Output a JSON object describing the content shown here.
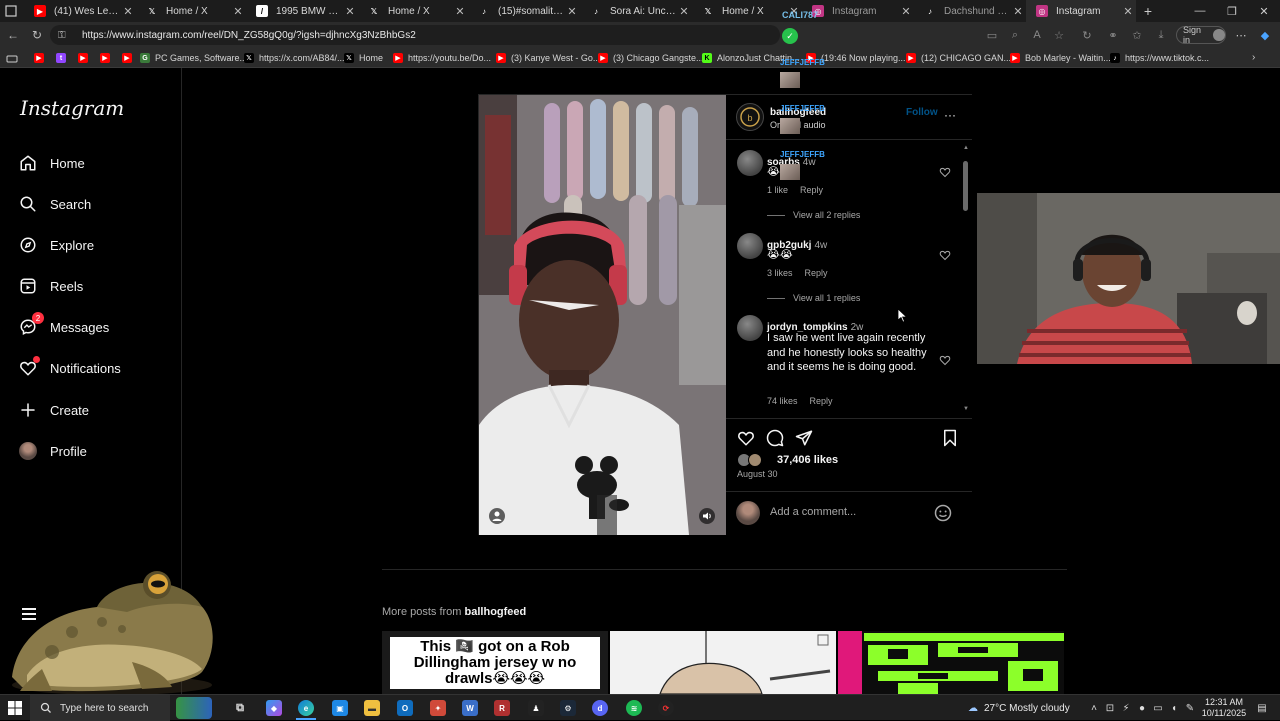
{
  "browser": {
    "tabs": [
      {
        "label": "(41) Wes Lee with th",
        "icon": "youtube-icon",
        "color": "#ff0000"
      },
      {
        "label": "Home / X",
        "icon": "x-icon",
        "color": "#000000"
      },
      {
        "label": "1995 BMW 850CSi",
        "icon": "site-icon",
        "color": "#333333"
      },
      {
        "label": "Home / X",
        "icon": "x-icon",
        "color": "#000000"
      },
      {
        "label": "(15)#somalitiktok |",
        "icon": "tiktok-icon",
        "color": "#000000"
      },
      {
        "label": "Sora Ai: Uncovering",
        "icon": "tiktok-icon",
        "color": "#000000"
      },
      {
        "label": "Home / X",
        "icon": "x-icon",
        "color": "#000000"
      },
      {
        "label": "Instagram",
        "icon": "instagram-icon",
        "color": "#c13584"
      },
      {
        "label": "Dachshund vs Vacu",
        "icon": "tiktok-icon",
        "color": "#000000"
      },
      {
        "label": "Instagram",
        "icon": "instagram-icon",
        "color": "#c13584"
      }
    ],
    "url": "https://www.instagram.com/reel/DN_ZG58gQ0g/?igsh=djhncXg3NzBhbGs2",
    "sign_in": "Sign in",
    "bookmarks": [
      "PC Games, Software...",
      "https://x.com/AB84/...",
      "Home",
      "https://youtu.be/Do...",
      "(3) Kanye West - Go...",
      "(3) Chicago Gangste...",
      "AlonzoJust Chattin...",
      "(19:46 Now playing...",
      "(12) CHICAGO GAN...",
      "Bob Marley - Waitin...",
      "https://www.tiktok.c..."
    ]
  },
  "instagram": {
    "logo": "Instagram",
    "nav": [
      {
        "label": "Home",
        "icon": "home-icon"
      },
      {
        "label": "Search",
        "icon": "search-icon"
      },
      {
        "label": "Explore",
        "icon": "compass-icon"
      },
      {
        "label": "Reels",
        "icon": "reels-icon"
      },
      {
        "label": "Messages",
        "icon": "messenger-icon",
        "badge": "2"
      },
      {
        "label": "Notifications",
        "icon": "heart-icon"
      },
      {
        "label": "Create",
        "icon": "plus-icon"
      },
      {
        "label": "Profile",
        "icon": "avatar-icon"
      }
    ],
    "post": {
      "username": "ballhogfeed",
      "audio": "Original audio",
      "follow": "Follow",
      "comments": [
        {
          "user": "soarbs",
          "time": "4w",
          "text": "😭😭",
          "likes": "1 like",
          "reply": "Reply",
          "view_replies": "View all 2 replies"
        },
        {
          "user": "gpb2gukj",
          "time": "4w",
          "text": "😭😭",
          "likes": "3 likes",
          "reply": "Reply",
          "view_replies": "View all 1 replies"
        },
        {
          "user": "jordyn_tompkins",
          "time": "2w",
          "text": "I saw he went live again recently and he honestly looks so healthy and it seems he is doing good.",
          "likes": "74 likes",
          "reply": "Reply"
        }
      ],
      "likes": "37,406 likes",
      "date": "August 30",
      "comment_placeholder": "Add a comment..."
    },
    "more_posts_prefix": "More posts from",
    "more_posts_user": "ballhogfeed",
    "thumb1_text": "This 🏴‍☠️ got on a Rob Dillingham jersey w no drawls😭😭😭"
  },
  "overlay": {
    "chat_top": "CALI787",
    "chat_names": [
      "JEFFJEFFB",
      "JEFFJEFFB",
      "JEFFJEFFB"
    ]
  },
  "taskbar": {
    "search_placeholder": "Type here to search",
    "weather": "27°C  Mostly cloudy",
    "time": "12:31 AM",
    "date": "10/11/2025"
  }
}
